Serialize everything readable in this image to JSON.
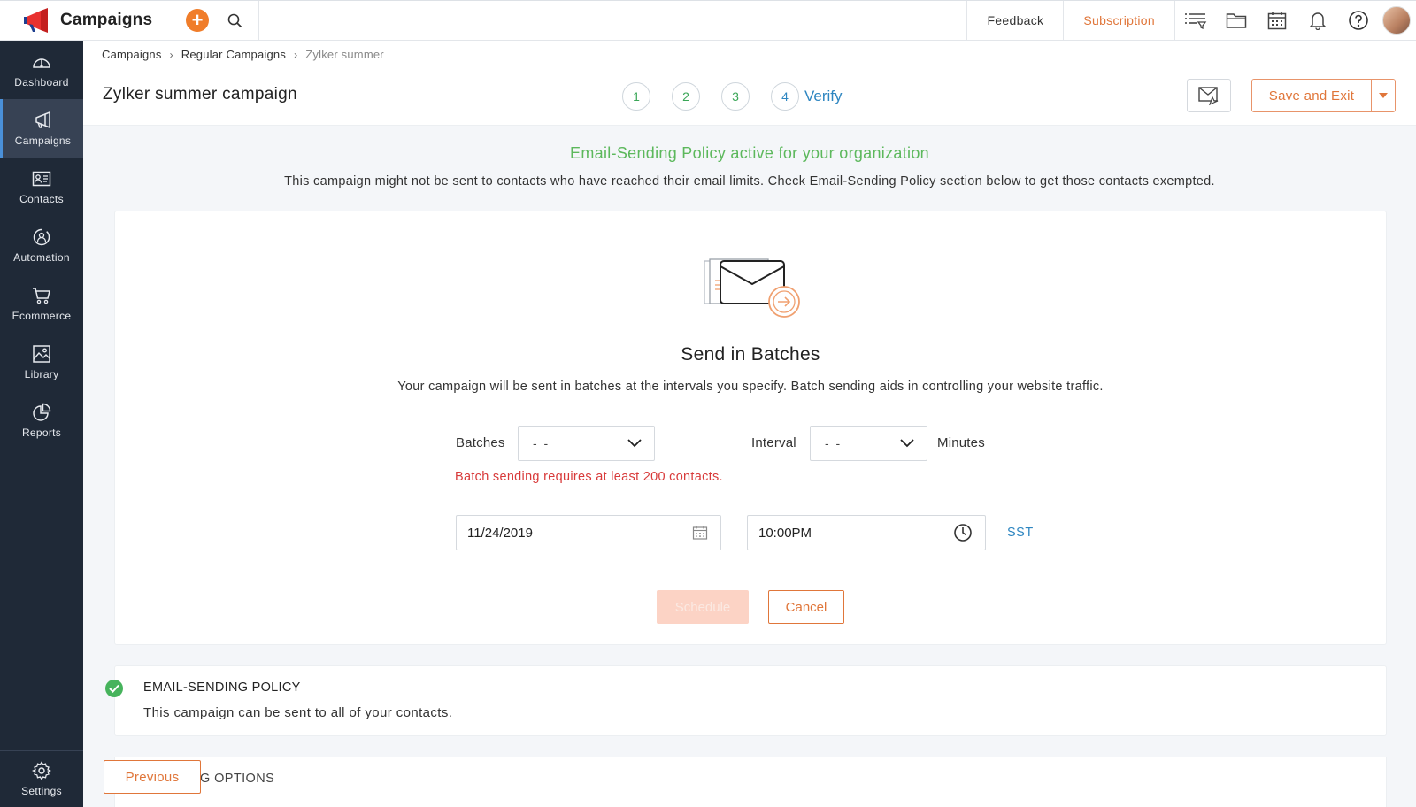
{
  "app": {
    "name": "Campaigns",
    "brand_icon": "megaphone-logo",
    "accent_color": "#f07d2a"
  },
  "topbar": {
    "add_icon": "plus-icon",
    "search_icon": "search-icon",
    "feedback_label": "Feedback",
    "subscription_label": "Subscription",
    "icons": [
      "list-filter-icon",
      "folder-icon",
      "calendar-icon",
      "bell-icon",
      "help-icon"
    ]
  },
  "sidebar": {
    "items": [
      {
        "label": "Dashboard",
        "icon": "gauge-icon",
        "active": false
      },
      {
        "label": "Campaigns",
        "icon": "megaphone-icon",
        "active": true
      },
      {
        "label": "Contacts",
        "icon": "contact-card-icon",
        "active": false
      },
      {
        "label": "Automation",
        "icon": "automation-icon",
        "active": false
      },
      {
        "label": "Ecommerce",
        "icon": "cart-icon",
        "active": false
      },
      {
        "label": "Library",
        "icon": "image-library-icon",
        "active": false
      },
      {
        "label": "Reports",
        "icon": "pie-chart-icon",
        "active": false
      }
    ],
    "settings_label": "Settings"
  },
  "breadcrumb": {
    "items": [
      "Campaigns",
      "Regular Campaigns",
      "Zylker summer"
    ]
  },
  "campaign": {
    "title": "Zylker summer campaign"
  },
  "steps": {
    "items": [
      "1",
      "2",
      "3",
      "4"
    ],
    "current_label": "Verify"
  },
  "header_actions": {
    "save_exit_label": "Save and Exit"
  },
  "policy_notice": {
    "title": "Email-Sending Policy active for your organization",
    "text": "This campaign might not be sent to contacts who have reached their email limits. Check Email-Sending Policy section below to get those contacts exempted."
  },
  "batch": {
    "title": "Send in Batches",
    "description": "Your campaign will be sent in batches at the intervals you specify. Batch sending aids in controlling your website traffic.",
    "batches_label": "Batches",
    "batches_value": "- -",
    "interval_label": "Interval",
    "interval_value": "- -",
    "minutes_label": "Minutes",
    "error": "Batch sending requires at least 200 contacts.",
    "date_value": "11/24/2019",
    "time_value": "10:00PM",
    "timezone": "SST",
    "schedule_label": "Schedule",
    "cancel_label": "Cancel"
  },
  "policy_section": {
    "title": "EMAIL-SENDING POLICY",
    "text": "This campaign can be sent to all of your contacts."
  },
  "bottom": {
    "section_label_partial": "G OPTIONS",
    "previous_label": "Previous"
  }
}
